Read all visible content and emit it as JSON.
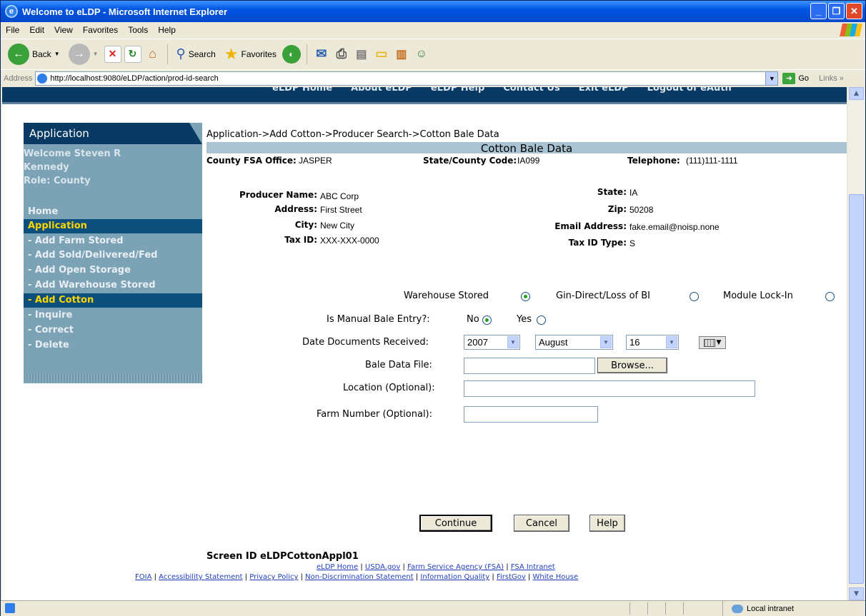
{
  "window": {
    "title": "Welcome to eLDP - Microsoft Internet Explorer"
  },
  "menu": [
    "File",
    "Edit",
    "View",
    "Favorites",
    "Tools",
    "Help"
  ],
  "toolbar": {
    "back": "Back",
    "search": "Search",
    "favorites": "Favorites"
  },
  "address": {
    "label": "Address",
    "url": "http://localhost:9080/eLDP/action/prod-id-search",
    "go": "Go",
    "links": "Links"
  },
  "topnav": [
    "eLDP Home",
    "About eLDP",
    "eLDP Help",
    "Contact Us",
    "Exit eLDP",
    "Logout of eAuth"
  ],
  "sidebar": {
    "title": "Application",
    "welcome": "Welcome  Steven R Kennedy",
    "role": "Role: County",
    "items": [
      {
        "label": "Home"
      },
      {
        "label": "Application"
      },
      {
        "label": "- Add Farm Stored"
      },
      {
        "label": "- Add Sold/Delivered/Fed"
      },
      {
        "label": "- Add Open Storage"
      },
      {
        "label": "- Add Warehouse Stored"
      },
      {
        "label": "- Add Cotton"
      },
      {
        "label": "- Inquire"
      },
      {
        "label": "- Correct"
      },
      {
        "label": "- Delete"
      }
    ]
  },
  "breadcrumb": "Application->Add Cotton->Producer Search->Cotton Bale Data",
  "section_title": "Cotton Bale Data",
  "office": {
    "county_label": "County FSA Office:",
    "county": "JASPER",
    "code_label": "State/County Code:",
    "code": "IA099",
    "phone_label": "Telephone:",
    "phone": "(111)111-1111"
  },
  "producer": {
    "name_label": "Producer Name:",
    "name": "ABC Corp",
    "address_label": "Address:",
    "address": "First Street",
    "city_label": "City:",
    "city": "New City",
    "taxid_label": "Tax ID:",
    "taxid": "XXX-XXX-0000",
    "state_label": "State:",
    "state": "IA",
    "zip_label": "Zip:",
    "zip": "50208",
    "email_label": "Email Address:",
    "email": "fake.email@noisp.none",
    "taxtype_label": "Tax ID Type:",
    "taxtype": "S"
  },
  "form": {
    "storage_options": [
      {
        "label": "Warehouse Stored",
        "checked": true
      },
      {
        "label": "Gin-Direct/Loss of BI",
        "checked": false
      },
      {
        "label": "Module Lock-In",
        "checked": false
      }
    ],
    "manual_label": "Is Manual Bale Entry?:",
    "manual_no": "No",
    "manual_yes": "Yes",
    "date_label": "Date Documents Received:",
    "year": "2007",
    "month": "August",
    "day": "16",
    "bale_label": "Bale Data File:",
    "browse": "Browse...",
    "location_label": "Location (Optional):",
    "farm_label": "Farm Number (Optional):",
    "bale_value": "",
    "location_value": "",
    "farm_value": ""
  },
  "buttons": {
    "continue": "Continue",
    "cancel": "Cancel",
    "help": "Help"
  },
  "screen_id": "Screen ID eLDPCottonAppl01",
  "footer_links_1": [
    "eLDP Home",
    "USDA.gov",
    "Farm Service Agency (FSA)",
    "FSA Intranet"
  ],
  "footer_links_2": [
    "FOIA",
    "Accessibility Statement",
    "Privacy Policy",
    "Non-Discrimination Statement",
    "Information Quality",
    "FirstGov",
    "White House"
  ],
  "status": {
    "zone": "Local intranet"
  }
}
